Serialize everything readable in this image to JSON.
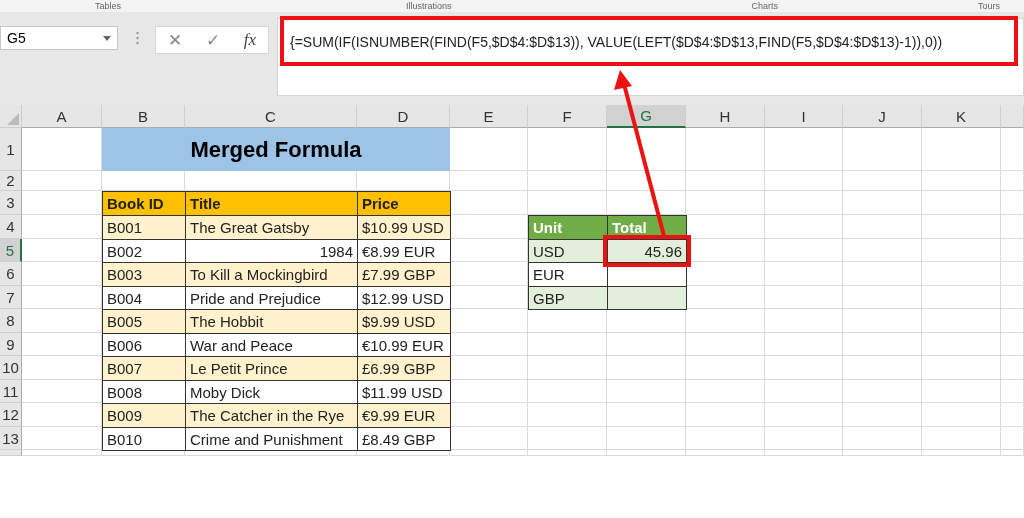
{
  "ribbon": {
    "groups": [
      "Tables",
      "Illustrations",
      "Charts",
      "Tours"
    ]
  },
  "formula_bar": {
    "name_box": "G5",
    "cancel": "✕",
    "enter": "✓",
    "function": "fx",
    "formula": "{=SUM(IF(ISNUMBER(FIND(F5,$D$4:$D$13)), VALUE(LEFT($D$4:$D$13,FIND(F5,$D$4:$D$13)-1)),0))"
  },
  "sheet": {
    "column_headers": [
      {
        "label": "A",
        "selected": false
      },
      {
        "label": "B",
        "selected": false
      },
      {
        "label": "C",
        "selected": false
      },
      {
        "label": "D",
        "selected": false
      },
      {
        "label": "E",
        "selected": false
      },
      {
        "label": "F",
        "selected": false
      },
      {
        "label": "G",
        "selected": true
      },
      {
        "label": "H",
        "selected": false
      },
      {
        "label": "I",
        "selected": false
      },
      {
        "label": "J",
        "selected": false
      },
      {
        "label": "K",
        "selected": false
      }
    ],
    "row_headers": [
      {
        "label": "1",
        "selected": false
      },
      {
        "label": "2",
        "selected": false
      },
      {
        "label": "3",
        "selected": false
      },
      {
        "label": "4",
        "selected": false
      },
      {
        "label": "5",
        "selected": true
      },
      {
        "label": "6",
        "selected": false
      },
      {
        "label": "7",
        "selected": false
      },
      {
        "label": "8",
        "selected": false
      },
      {
        "label": "9",
        "selected": false
      },
      {
        "label": "10",
        "selected": false
      },
      {
        "label": "11",
        "selected": false
      },
      {
        "label": "12",
        "selected": false
      },
      {
        "label": "13",
        "selected": false
      }
    ],
    "title": "Merged Formula",
    "books": {
      "columns": [
        "Book ID",
        "Title",
        "Price"
      ],
      "rows": [
        {
          "book_id": "B001",
          "title": "The Great Gatsby",
          "price": "$10.99 USD",
          "shaded": true,
          "title_right_aligned": false
        },
        {
          "book_id": "B002",
          "title": "1984",
          "price": "€8.99 EUR",
          "shaded": false,
          "title_right_aligned": true
        },
        {
          "book_id": "B003",
          "title": "To Kill a Mockingbird",
          "price": "£7.99 GBP",
          "shaded": true,
          "title_right_aligned": false
        },
        {
          "book_id": "B004",
          "title": "Pride and Prejudice",
          "price": "$12.99 USD",
          "shaded": false,
          "title_right_aligned": false
        },
        {
          "book_id": "B005",
          "title": "The Hobbit",
          "price": "$9.99 USD",
          "shaded": true,
          "title_right_aligned": false
        },
        {
          "book_id": "B006",
          "title": "War and Peace",
          "price": "€10.99 EUR",
          "shaded": false,
          "title_right_aligned": false
        },
        {
          "book_id": "B007",
          "title": "Le Petit Prince",
          "price": "£6.99 GBP",
          "shaded": true,
          "title_right_aligned": false
        },
        {
          "book_id": "B008",
          "title": "Moby Dick",
          "price": "$11.99 USD",
          "shaded": false,
          "title_right_aligned": false
        },
        {
          "book_id": "B009",
          "title": "The Catcher in the Rye",
          "price": "€9.99 EUR",
          "shaded": true,
          "title_right_aligned": false
        },
        {
          "book_id": "B010",
          "title": "Crime and Punishment",
          "price": "£8.49 GBP",
          "shaded": false,
          "title_right_aligned": false
        }
      ]
    },
    "totals": {
      "columns": [
        "Unit",
        "Total"
      ],
      "rows": [
        {
          "unit": "USD",
          "total": "45.96",
          "shaded": true,
          "selected": true
        },
        {
          "unit": "EUR",
          "shaded": false,
          "selected": false
        },
        {
          "unit": "GBP",
          "shaded": true,
          "selected": false
        }
      ]
    }
  }
}
